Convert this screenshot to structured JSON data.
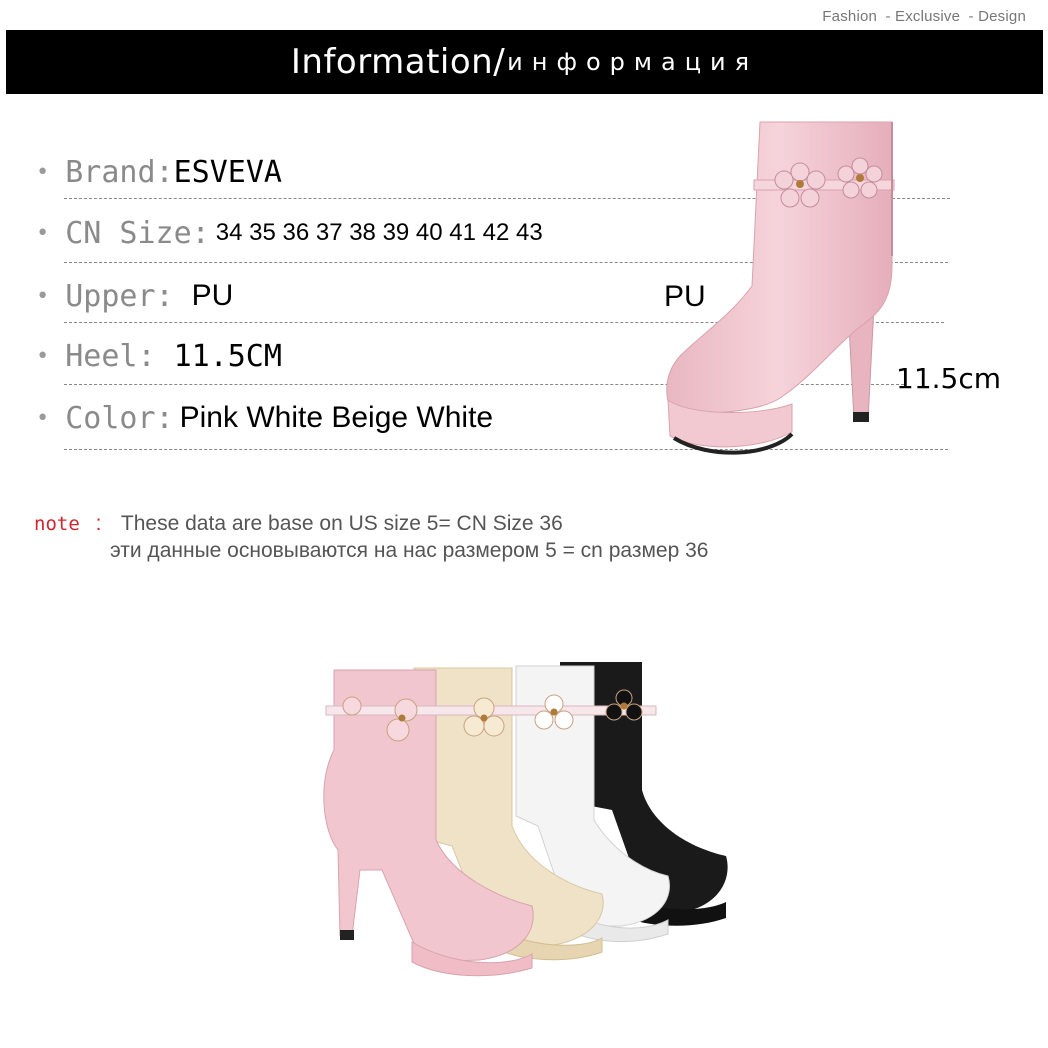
{
  "header": {
    "tagline": [
      "Fashion",
      "- Exclusive",
      "- Design"
    ],
    "title_en": "Information/",
    "title_ru": "информация"
  },
  "info": {
    "brand": {
      "label": "Brand:",
      "value": "ESVEVA"
    },
    "size": {
      "label": "CN Size:",
      "value": "34 35 36 37 38 39 40 41 42 43"
    },
    "upper": {
      "label": "Upper:",
      "value": "PU"
    },
    "heel": {
      "label": "Heel:",
      "value": "11.5CM"
    },
    "color": {
      "label": "Color:",
      "value": "Pink White Beige White"
    }
  },
  "callouts": {
    "upper": "PU",
    "heel": "11.5cm"
  },
  "note": {
    "label": "note",
    "colon": ":",
    "line1": "These data are base on US size 5= CN Size 36",
    "line2": "эти данные основываются на нас размером 5 = cn размер 36"
  },
  "colors": {
    "banner": "#000000",
    "note_label": "#d0262e",
    "boot_pink": "#f2c6cf",
    "boot_beige": "#efe2c6",
    "boot_white": "#f4f4f4",
    "boot_black": "#1a1a1a"
  },
  "images": {
    "hero": "pink-ankle-boot",
    "group": "four-boots-colors"
  }
}
